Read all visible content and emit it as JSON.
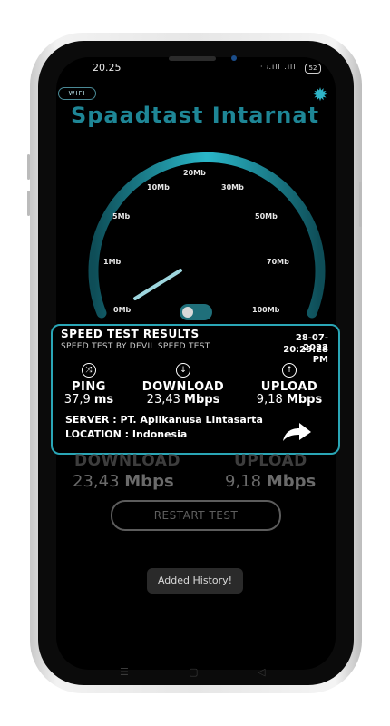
{
  "status_bar": {
    "time": "20.25",
    "icons": "· ᵢ.ıll .ıll",
    "battery": "52"
  },
  "header": {
    "wifi_badge": "WIFI",
    "title": "Spaadtast Intarnat"
  },
  "gauge": {
    "labels": [
      "0Mb",
      "1Mb",
      "5Mb",
      "10Mb",
      "20Mb",
      "30Mb",
      "50Mb",
      "70Mb",
      "100Mb"
    ],
    "needle_value": "1Mb",
    "accent_color": "#22a6b6"
  },
  "results_card": {
    "title": "SPEED TEST RESULTS",
    "subtitle": "SPEED TEST BY DEVIL SPEED TEST",
    "date": "28-07-2022",
    "time": "20:25:28 PM",
    "ping": {
      "label": "PING",
      "value": "37,9",
      "unit": "ms",
      "icon": "shuffle-icon"
    },
    "download": {
      "label": "DOWNLOAD",
      "value": "23,43",
      "unit": "Mbps",
      "icon": "arrow-down-circle-icon"
    },
    "upload": {
      "label": "UPLOAD",
      "value": "9,18",
      "unit": "Mbps",
      "icon": "arrow-up-circle-icon"
    },
    "server": "SERVER : PT. Aplikanusa Lintasarta",
    "location": "LOCATION : Indonesia"
  },
  "summary": {
    "download_label": "DOWNLOAD",
    "download_value": "23,43",
    "download_unit": "Mbps",
    "upload_label": "UPLOAD",
    "upload_value": "9,18",
    "upload_unit": "Mbps"
  },
  "buttons": {
    "restart": "RESTART TEST"
  },
  "toast": "Added History!",
  "nav": {
    "menu": "☰",
    "home": "▢",
    "back": "◁"
  }
}
